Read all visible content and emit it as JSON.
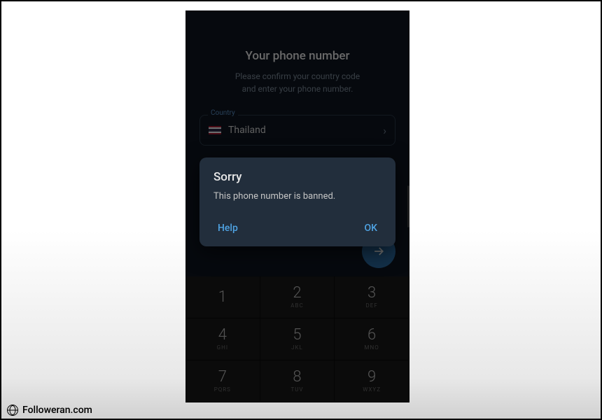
{
  "header": {
    "title": "Your phone number",
    "subtitle_line1": "Please confirm your country code",
    "subtitle_line2": "and enter your phone number."
  },
  "country": {
    "label": "Country",
    "name": "Thailand"
  },
  "dialog": {
    "title": "Sorry",
    "message": "This phone number is banned.",
    "help_label": "Help",
    "ok_label": "OK"
  },
  "keypad": {
    "keys": [
      {
        "digit": "1",
        "letters": ""
      },
      {
        "digit": "2",
        "letters": "ABC"
      },
      {
        "digit": "3",
        "letters": "DEF"
      },
      {
        "digit": "4",
        "letters": "GHI"
      },
      {
        "digit": "5",
        "letters": "JKL"
      },
      {
        "digit": "6",
        "letters": "MNO"
      },
      {
        "digit": "7",
        "letters": "PQRS"
      },
      {
        "digit": "8",
        "letters": "TUV"
      },
      {
        "digit": "9",
        "letters": "WXYZ"
      }
    ]
  },
  "watermark": {
    "text": "Followeran.com"
  }
}
